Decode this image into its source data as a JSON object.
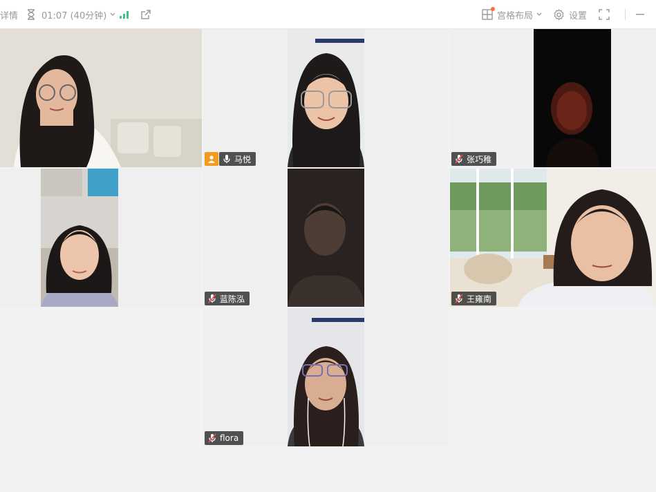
{
  "toolbar": {
    "details_label": "详情",
    "timer_label": "01:07 (40分钟)",
    "layout_label": "宫格布局",
    "settings_label": "设置"
  },
  "participants": [
    {
      "name": ""
    },
    {
      "name": "马悦",
      "host": true
    },
    {
      "name": "张巧稚"
    },
    {
      "name": ""
    },
    {
      "name": "蓝陈泓"
    },
    {
      "name": "王雍南"
    },
    {
      "name": "flora"
    }
  ]
}
